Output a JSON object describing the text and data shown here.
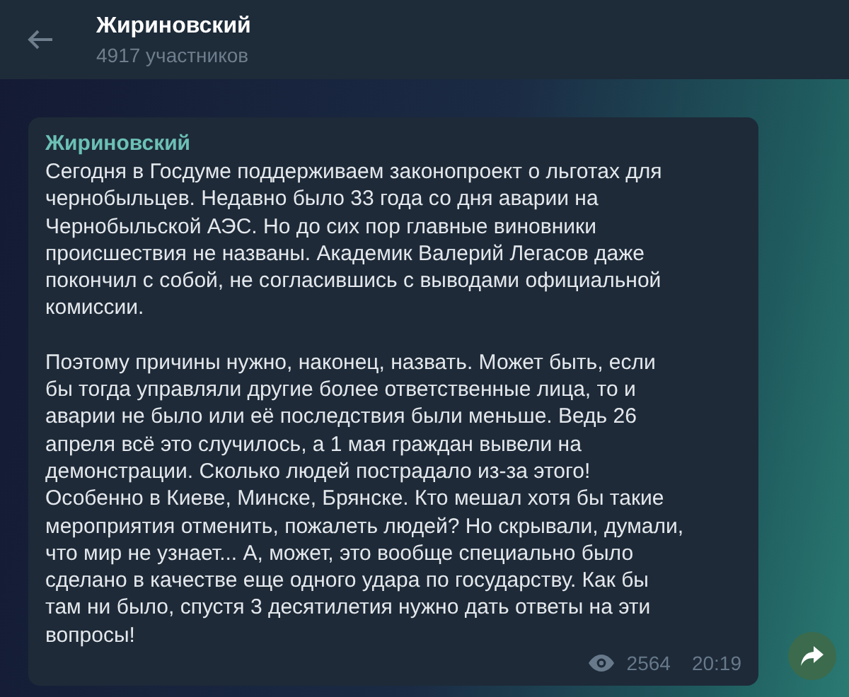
{
  "header": {
    "title": "Жириновский",
    "subtitle": "4917 участников"
  },
  "message": {
    "author": "Жириновский",
    "paragraphs": [
      {
        "lines": [
          "Сегодня в Госдуме поддерживаем законопроект о льготах для",
          "чернобыльцев. Недавно было 33 года со дня аварии на",
          "Чернобыльской АЭС. Но до сих пор главные виновники",
          "происшествия не названы. Академик Валерий Легасов даже",
          "покончил с собой, не согласившись с выводами официальной",
          "комиссии."
        ]
      },
      {
        "lines": [
          "Поэтому причины нужно, наконец, назвать. Может быть, если",
          "бы тогда управляли другие более ответственные лица, то и",
          "аварии не было или её последствия были меньше. Ведь 26",
          "апреля всё это случилось, а 1 мая граждан вывели на",
          "демонстрации. Сколько людей пострадало из-за этого!",
          "Особенно в Киеве, Минске, Брянске. Кто мешал хотя бы такие",
          "мероприятия отменить, пожалеть людей? Но скрывали, думали,",
          "что мир не узнает... А, может, это вообще специально было",
          "сделано в качестве еще одного удара по государству. Как бы",
          "там ни было, спустя 3 десятилетия нужно дать ответы на эти",
          "вопросы!"
        ]
      }
    ],
    "views": "2564",
    "time": "20:19"
  }
}
